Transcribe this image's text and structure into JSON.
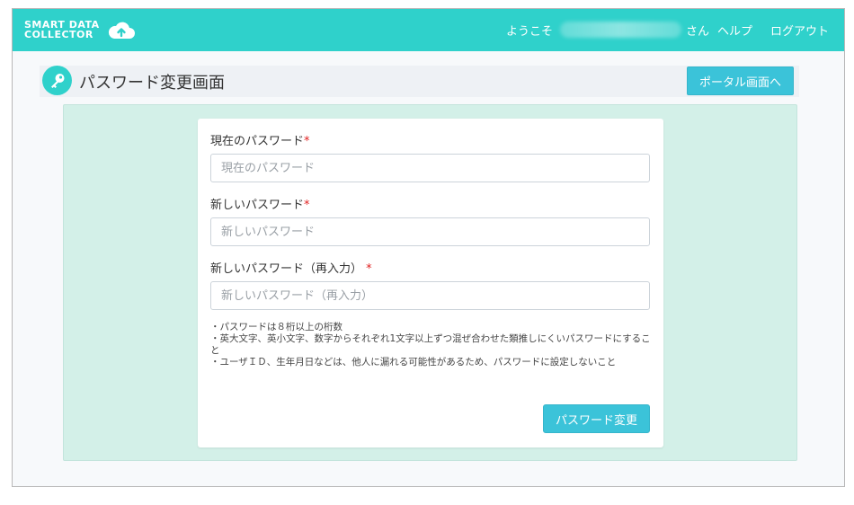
{
  "header": {
    "logo_line1": "SMART DATA",
    "logo_line2": "COLLECTOR",
    "logo_icon": "cloud-upload-icon",
    "welcome": "ようこそ",
    "username_suffix": "さん",
    "help": "ヘルプ",
    "logout": "ログアウト",
    "bg_color": "#2fd1cb"
  },
  "page": {
    "title": "パスワード変更画面",
    "title_icon": "key-icon",
    "portal_button": "ポータル画面へ"
  },
  "form": {
    "current_label": "現在のパスワード",
    "current_placeholder": "現在のパスワード",
    "new_label": "新しいパスワード",
    "new_placeholder": "新しいパスワード",
    "confirm_label": "新しいパスワード（再入力）",
    "confirm_placeholder": "新しいパスワード（再入力）",
    "required_mark": "*",
    "notes": [
      "・パスワードは８桁以上の桁数",
      "・英大文字、英小文字、数字からそれぞれ1文字以上ずつ混ぜ合わせた類推しにくいパスワードにすること",
      "・ユーザＩＤ、生年月日などは、他人に漏れる可能性があるため、パスワードに設定しないこと"
    ],
    "submit": "パスワード変更"
  },
  "colors": {
    "accent": "#2fd1cb",
    "button": "#3bc3d9",
    "panel": "#d3f0e8",
    "required": "#e02020"
  }
}
